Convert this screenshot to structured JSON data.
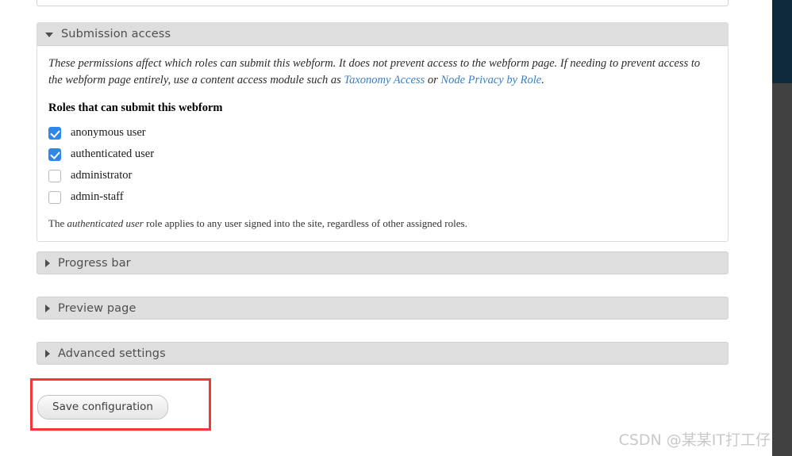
{
  "panels": {
    "submission_access": {
      "title": "Submission access",
      "expanded": true,
      "description_part1": "These permissions affect which roles can submit this webform. It does not prevent access to the webform page. If needing to prevent access to the webform page entirely, use a content access module such as ",
      "link1": "Taxonomy Access",
      "description_mid": " or ",
      "link2": "Node Privacy by Role",
      "description_end": ".",
      "fieldset_label": "Roles that can submit this webform",
      "roles": [
        {
          "label": "anonymous user",
          "checked": true
        },
        {
          "label": "authenticated user",
          "checked": true
        },
        {
          "label": "administrator",
          "checked": false
        },
        {
          "label": "admin-staff",
          "checked": false
        }
      ],
      "note_prefix": "The ",
      "note_emphasis": "authenticated user",
      "note_suffix": " role applies to any user signed into the site, regardless of other assigned roles."
    },
    "collapsed": [
      {
        "title": "Progress bar"
      },
      {
        "title": "Preview page"
      },
      {
        "title": "Advanced settings"
      }
    ]
  },
  "actions": {
    "save_label": "Save configuration"
  },
  "watermark": "CSDN @某某IT打工仔",
  "colors": {
    "checkbox_on": "#2f87eb",
    "link": "#3a7fc1",
    "highlight_border": "#f4383a",
    "panel_header": "#dedede",
    "rail_top": "#102a3d",
    "rail_bottom": "#414141"
  }
}
